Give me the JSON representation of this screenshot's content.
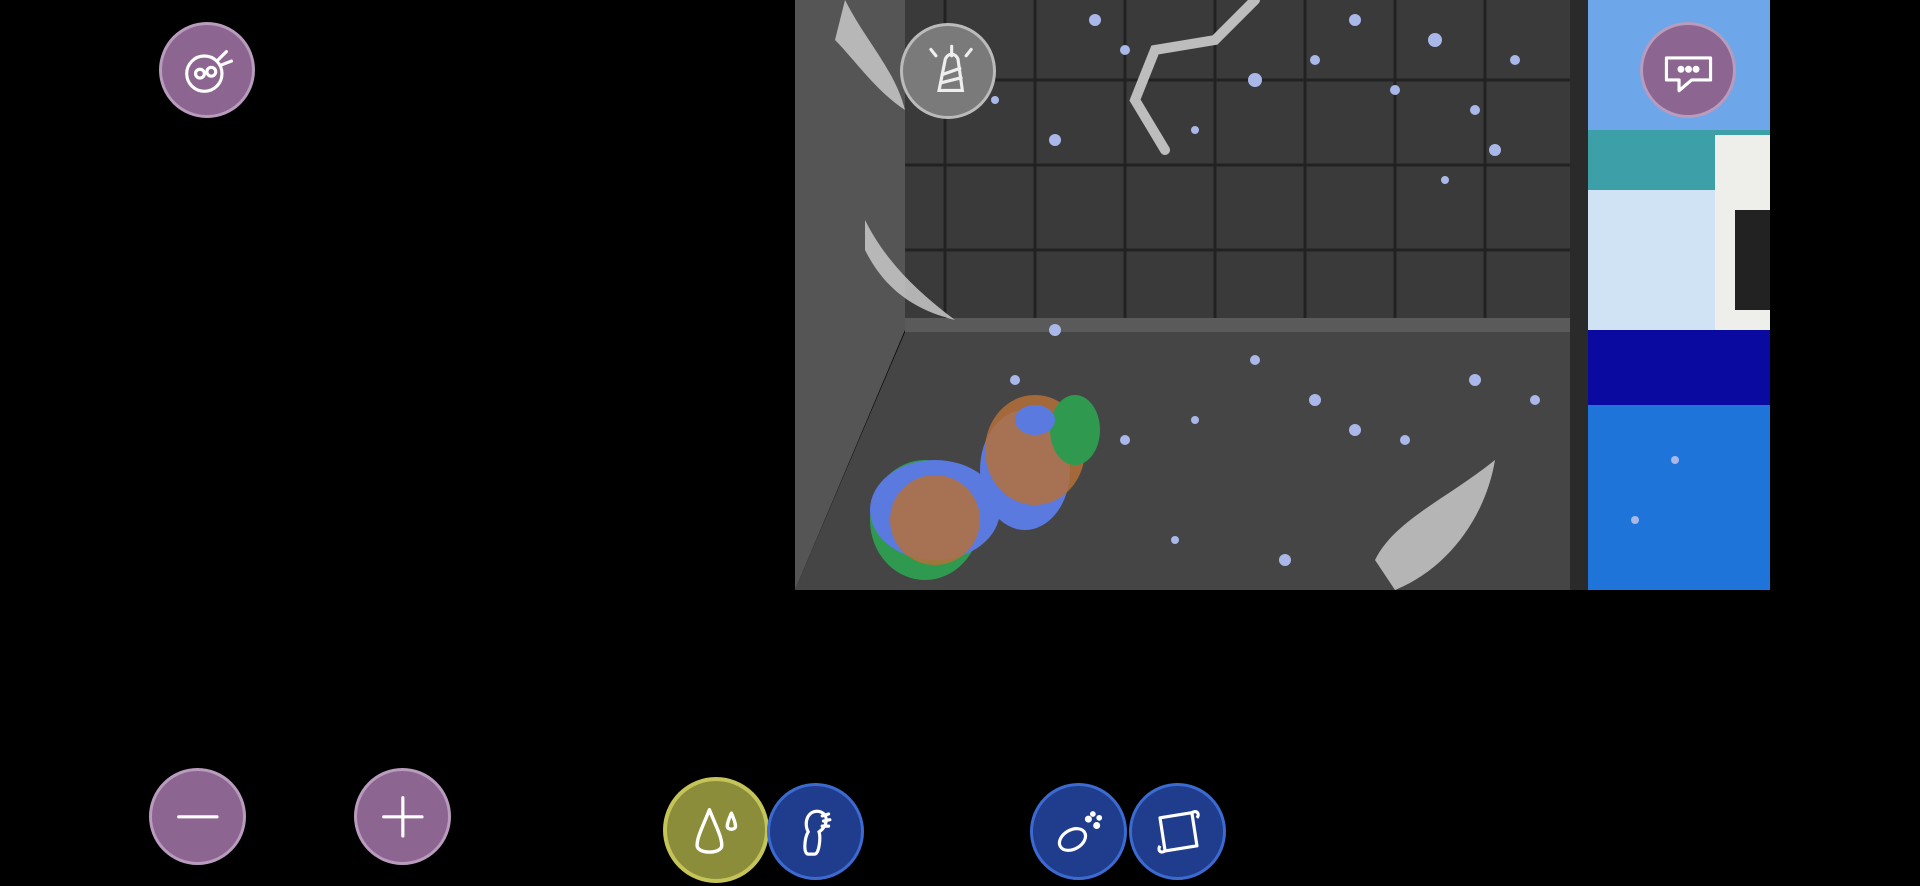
{
  "scene": {
    "name": "shower-bathing-scene",
    "colors": {
      "wall": "#3a3a3a",
      "floor": "#454545",
      "grid": "#222222",
      "water": "#a9b8e8",
      "pet_blue": "#5a7ae0",
      "pet_green": "#2f9a4f",
      "dirt": "#b5703a",
      "room_sky": "#6ea6ea",
      "room_navy": "#0a0aa0",
      "room_floor": "#1f74d9"
    }
  },
  "top_left": {
    "icon": "pet-face-icon"
  },
  "top_right": {
    "icon": "chat-bubble-icon"
  },
  "shower_head": {
    "icon": "shower-head-icon"
  },
  "zoom": {
    "out_icon": "minus-icon",
    "in_icon": "plus-icon"
  },
  "tools": [
    {
      "id": "water",
      "icon": "water-drop-icon",
      "selected": true
    },
    {
      "id": "brush",
      "icon": "brush-icon",
      "selected": false
    },
    {
      "id": "soap",
      "icon": "soap-icon",
      "selected": false
    },
    {
      "id": "towel",
      "icon": "towel-icon",
      "selected": false
    }
  ]
}
